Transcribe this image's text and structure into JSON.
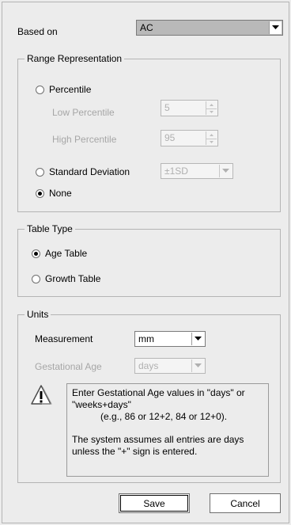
{
  "based_on": {
    "label": "Based on",
    "value": "AC"
  },
  "range": {
    "legend": "Range Representation",
    "percentile_label": "Percentile",
    "low_label": "Low Percentile",
    "low_value": "5",
    "high_label": "High Percentile",
    "high_value": "95",
    "sd_label": "Standard Deviation",
    "sd_value": "±1SD",
    "none_label": "None",
    "selected": "None"
  },
  "table_type": {
    "legend": "Table Type",
    "age_label": "Age Table",
    "growth_label": "Growth Table",
    "selected": "Age Table"
  },
  "units": {
    "legend": "Units",
    "measurement_label": "Measurement",
    "measurement_value": "mm",
    "ga_label": "Gestational Age",
    "ga_value": "days",
    "info_line1": "Enter Gestational Age values in \"days\" or \"weeks+days\"",
    "info_line2": "(e.g., 86 or 12+2, 84 or 12+0).",
    "info_line3": "The system assumes all entries are days unless the \"+\" sign is entered."
  },
  "buttons": {
    "save": "Save",
    "cancel": "Cancel"
  },
  "icons": {
    "warning": "warning-icon",
    "dropdown": "chevron-down-icon"
  }
}
